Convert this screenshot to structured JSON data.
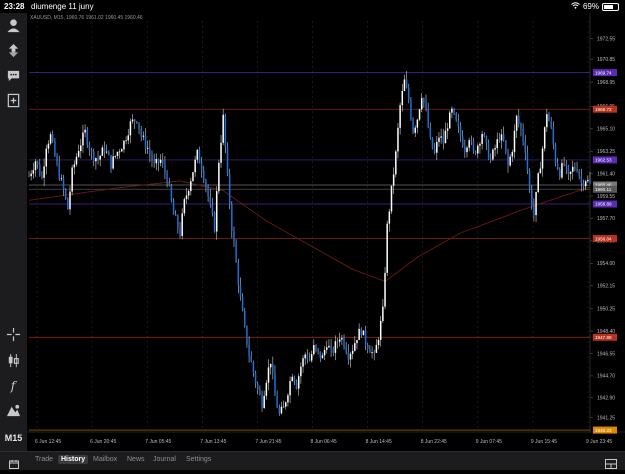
{
  "status": {
    "time": "23:28",
    "date": "diumenge 11 juny",
    "battery": "69%",
    "battery_level": 0.69
  },
  "chart": {
    "symbol_line": "XAUUSD, M15, 1960.76 1961.02 1960.45 1960.46",
    "price_labels": [
      "1972.55",
      "1970.85",
      "1968.95",
      "1966.95",
      "1965.10",
      "1963.25",
      "1961.40",
      "1959.55",
      "1957.70",
      "1955.85",
      "1954.00",
      "1952.15",
      "1950.25",
      "1948.40",
      "1946.55",
      "1944.70",
      "1942.90",
      "1941.25"
    ],
    "time_labels": [
      "6 Jun 12:45",
      "6 Jun 20:45",
      "7 Jun 05:45",
      "7 Jun 13:45",
      "7 Jun 21:45",
      "8 Jun 06:45",
      "8 Jun 14:45",
      "8 Jun 22:45",
      "9 Jun 07:45",
      "9 Jun 15:45",
      "9 Jun 23:45"
    ],
    "level_tags": [
      {
        "name": "purple-top",
        "value": "1969.74",
        "color": "#5b2bb5"
      },
      {
        "name": "red-top",
        "value": "1966.72",
        "color": "#b8321c"
      },
      {
        "name": "purple-mid",
        "value": "1962.53",
        "color": "#5b2bb5"
      },
      {
        "name": "bid",
        "value": "1960.46",
        "color": "#7a7a7a"
      },
      {
        "name": "ask",
        "value": "1960.11",
        "color": "#5a5a5a"
      },
      {
        "name": "purple-low",
        "value": "1958.89",
        "color": "#5b2bb5"
      },
      {
        "name": "red-mid",
        "value": "1956.04",
        "color": "#b8321c"
      },
      {
        "name": "red-low",
        "value": "1947.89",
        "color": "#b8321c"
      },
      {
        "name": "orange-bottom",
        "value": "1940.23",
        "color": "#e08a00"
      }
    ]
  },
  "chart_data": {
    "type": "candlestick",
    "symbol": "XAUUSD",
    "timeframe": "M15",
    "ylim": [
      1940.4,
      1974.0
    ],
    "x_labels": [
      "6 Jun 12:45",
      "6 Jun 20:45",
      "7 Jun 05:45",
      "7 Jun 13:45",
      "7 Jun 21:45",
      "8 Jun 06:45",
      "8 Jun 14:45",
      "8 Jun 22:45",
      "9 Jun 07:45",
      "9 Jun 15:45",
      "9 Jun 23:45"
    ],
    "close_path": [
      [
        0,
        1961.2
      ],
      [
        3,
        1962.5
      ],
      [
        6,
        1961.0
      ],
      [
        8,
        1963.8
      ],
      [
        10,
        1964.5
      ],
      [
        13,
        1962.0
      ],
      [
        16,
        1960.0
      ],
      [
        18,
        1958.5
      ],
      [
        20,
        1961.5
      ],
      [
        23,
        1963.5
      ],
      [
        26,
        1964.8
      ],
      [
        29,
        1963.0
      ],
      [
        32,
        1962.6
      ],
      [
        35,
        1963.5
      ],
      [
        38,
        1962.2
      ],
      [
        41,
        1963.2
      ],
      [
        44,
        1964.0
      ],
      [
        47,
        1965.5
      ],
      [
        50,
        1966.0
      ],
      [
        52,
        1964.5
      ],
      [
        55,
        1963.5
      ],
      [
        58,
        1962.0
      ],
      [
        61,
        1962.5
      ],
      [
        64,
        1961.0
      ],
      [
        67,
        1958.0
      ],
      [
        70,
        1956.5
      ],
      [
        72,
        1959.0
      ],
      [
        75,
        1961.0
      ],
      [
        78,
        1963.0
      ],
      [
        80,
        1962.0
      ],
      [
        82,
        1960.5
      ],
      [
        84,
        1958.5
      ],
      [
        86,
        1957.0
      ],
      [
        88,
        1962.5
      ],
      [
        90,
        1966.0
      ],
      [
        92,
        1961.0
      ],
      [
        94,
        1957.0
      ],
      [
        96,
        1954.0
      ],
      [
        98,
        1951.0
      ],
      [
        100,
        1948.5
      ],
      [
        102,
        1946.5
      ],
      [
        104,
        1945.0
      ],
      [
        106,
        1943.5
      ],
      [
        108,
        1942.5
      ],
      [
        110,
        1944.5
      ],
      [
        112,
        1946.0
      ],
      [
        114,
        1943.0
      ],
      [
        116,
        1941.5
      ],
      [
        118,
        1942.0
      ],
      [
        120,
        1943.5
      ],
      [
        122,
        1945.0
      ],
      [
        124,
        1944.0
      ],
      [
        126,
        1945.5
      ],
      [
        128,
        1946.5
      ],
      [
        130,
        1946.0
      ],
      [
        132,
        1947.0
      ],
      [
        134,
        1946.5
      ],
      [
        136,
        1946.2
      ],
      [
        138,
        1947.5
      ],
      [
        140,
        1946.5
      ],
      [
        142,
        1947.2
      ],
      [
        144,
        1948.0
      ],
      [
        146,
        1947.5
      ],
      [
        148,
        1946.5
      ],
      [
        150,
        1947.0
      ],
      [
        152,
        1948.0
      ],
      [
        154,
        1948.5
      ],
      [
        156,
        1947.5
      ],
      [
        158,
        1947.0
      ],
      [
        160,
        1946.2
      ],
      [
        162,
        1948.0
      ],
      [
        164,
        1950.0
      ],
      [
        166,
        1957.0
      ],
      [
        168,
        1960.0
      ],
      [
        170,
        1963.0
      ],
      [
        172,
        1967.0
      ],
      [
        174,
        1969.0
      ],
      [
        176,
        1967.5
      ],
      [
        178,
        1965.0
      ],
      [
        180,
        1966.0
      ],
      [
        182,
        1968.0
      ],
      [
        184,
        1966.5
      ],
      [
        186,
        1964.0
      ],
      [
        188,
        1963.0
      ],
      [
        190,
        1964.5
      ],
      [
        192,
        1964.0
      ],
      [
        194,
        1965.5
      ],
      [
        196,
        1966.5
      ],
      [
        198,
        1965.5
      ],
      [
        200,
        1964.5
      ],
      [
        202,
        1963.5
      ],
      [
        204,
        1964.5
      ],
      [
        206,
        1963.0
      ],
      [
        208,
        1963.8
      ],
      [
        210,
        1964.8
      ],
      [
        212,
        1963.5
      ],
      [
        214,
        1962.5
      ],
      [
        216,
        1963.5
      ],
      [
        218,
        1964.5
      ],
      [
        220,
        1964.0
      ],
      [
        222,
        1962.0
      ],
      [
        224,
        1963.5
      ],
      [
        226,
        1966.0
      ],
      [
        228,
        1965.0
      ],
      [
        230,
        1963.5
      ],
      [
        232,
        1960.0
      ],
      [
        234,
        1958.0
      ],
      [
        236,
        1961.0
      ],
      [
        238,
        1963.5
      ],
      [
        240,
        1966.5
      ],
      [
        242,
        1965.0
      ],
      [
        244,
        1962.5
      ],
      [
        246,
        1961.5
      ],
      [
        248,
        1962.2
      ],
      [
        250,
        1961.0
      ],
      [
        252,
        1961.8
      ],
      [
        254,
        1962.0
      ],
      [
        256,
        1960.6
      ],
      [
        258,
        1961.0
      ],
      [
        260,
        1960.5
      ]
    ],
    "moving_average_dark_red": [
      [
        0,
        1959.2
      ],
      [
        40,
        1960.2
      ],
      [
        70,
        1960.8
      ],
      [
        90,
        1960.0
      ],
      [
        110,
        1957.5
      ],
      [
        130,
        1955.5
      ],
      [
        150,
        1953.5
      ],
      [
        165,
        1952.5
      ],
      [
        180,
        1954.5
      ],
      [
        200,
        1956.5
      ],
      [
        230,
        1958.5
      ],
      [
        260,
        1960.3
      ]
    ],
    "levels": [
      1969.74,
      1966.72,
      1962.53,
      1958.89,
      1956.04,
      1947.89,
      1940.23
    ],
    "bid": 1960.46,
    "ask": 1960.11
  },
  "bottom_tabs": [
    "Trade",
    "History",
    "Mailbox",
    "News",
    "Journal",
    "Settings"
  ],
  "active_tab": "History",
  "toolbar": {
    "timeframe": "M15"
  }
}
